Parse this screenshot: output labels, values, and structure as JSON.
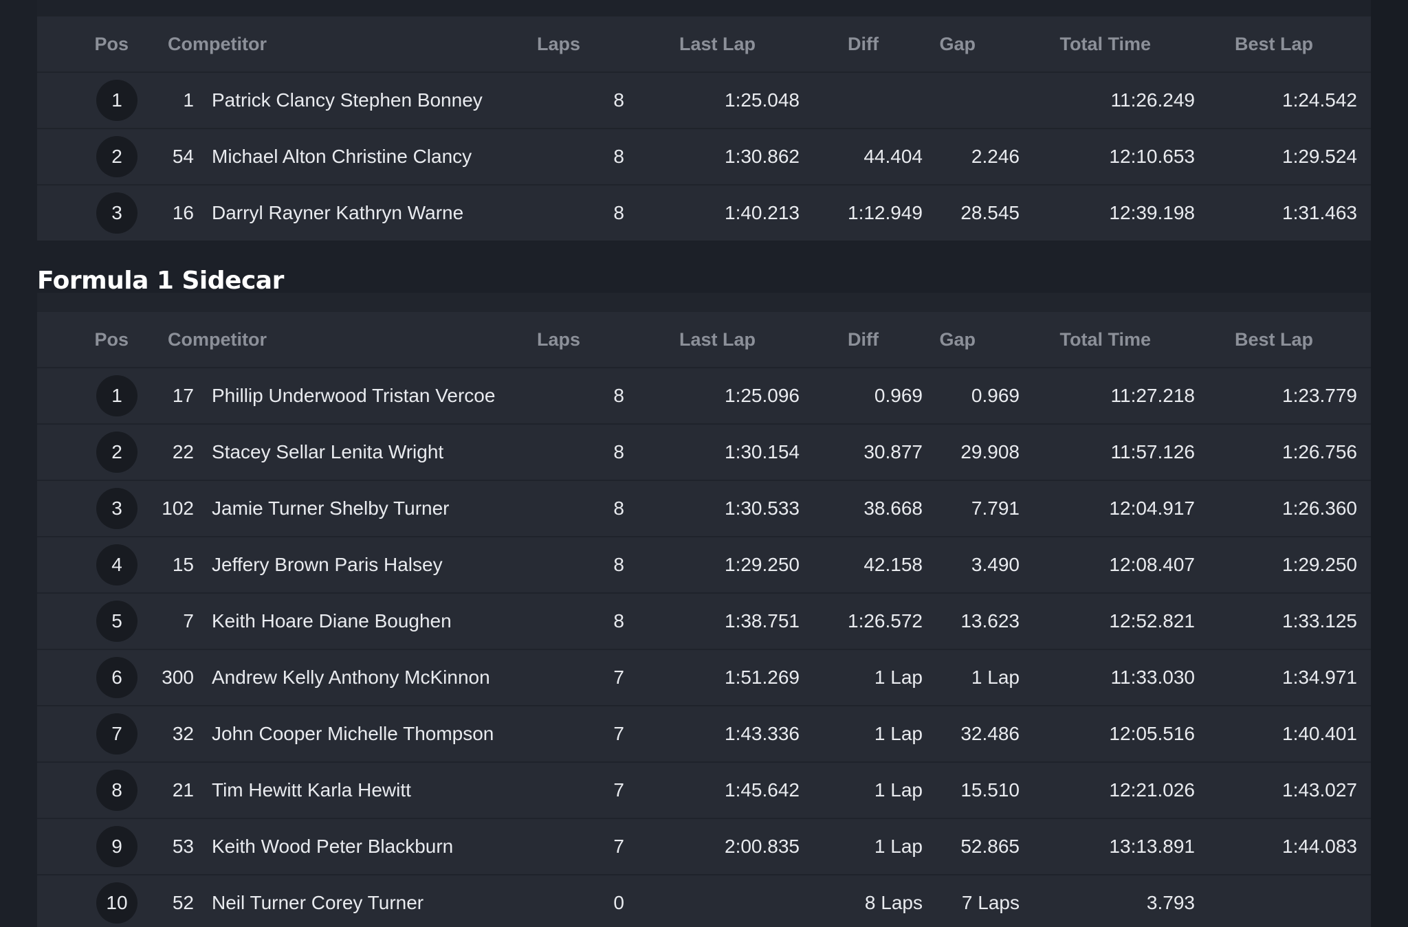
{
  "columns": {
    "pos": "Pos",
    "competitor": "Competitor",
    "laps": "Laps",
    "last_lap": "Last Lap",
    "diff": "Diff",
    "gap": "Gap",
    "total_time": "Total Time",
    "best_lap": "Best Lap"
  },
  "table1": {
    "rows": [
      {
        "pos": "1",
        "num": "1",
        "competitor": "Patrick Clancy Stephen Bonney",
        "laps": "8",
        "last_lap": "1:25.048",
        "diff": "",
        "gap": "",
        "total_time": "11:26.249",
        "best_lap": "1:24.542"
      },
      {
        "pos": "2",
        "num": "54",
        "competitor": "Michael Alton Christine Clancy",
        "laps": "8",
        "last_lap": "1:30.862",
        "diff": "44.404",
        "gap": "2.246",
        "total_time": "12:10.653",
        "best_lap": "1:29.524"
      },
      {
        "pos": "3",
        "num": "16",
        "competitor": "Darryl Rayner Kathryn Warne",
        "laps": "8",
        "last_lap": "1:40.213",
        "diff": "1:12.949",
        "gap": "28.545",
        "total_time": "12:39.198",
        "best_lap": "1:31.463"
      }
    ]
  },
  "section2": {
    "title": "Formula 1 Sidecar"
  },
  "table2": {
    "rows": [
      {
        "pos": "1",
        "num": "17",
        "competitor": "Phillip Underwood Tristan Vercoe",
        "laps": "8",
        "last_lap": "1:25.096",
        "diff": "0.969",
        "gap": "0.969",
        "total_time": "11:27.218",
        "best_lap": "1:23.779"
      },
      {
        "pos": "2",
        "num": "22",
        "competitor": "Stacey Sellar Lenita Wright",
        "laps": "8",
        "last_lap": "1:30.154",
        "diff": "30.877",
        "gap": "29.908",
        "total_time": "11:57.126",
        "best_lap": "1:26.756"
      },
      {
        "pos": "3",
        "num": "102",
        "competitor": "Jamie Turner Shelby Turner",
        "laps": "8",
        "last_lap": "1:30.533",
        "diff": "38.668",
        "gap": "7.791",
        "total_time": "12:04.917",
        "best_lap": "1:26.360"
      },
      {
        "pos": "4",
        "num": "15",
        "competitor": "Jeffery Brown Paris Halsey",
        "laps": "8",
        "last_lap": "1:29.250",
        "diff": "42.158",
        "gap": "3.490",
        "total_time": "12:08.407",
        "best_lap": "1:29.250"
      },
      {
        "pos": "5",
        "num": "7",
        "competitor": "Keith Hoare Diane Boughen",
        "laps": "8",
        "last_lap": "1:38.751",
        "diff": "1:26.572",
        "gap": "13.623",
        "total_time": "12:52.821",
        "best_lap": "1:33.125"
      },
      {
        "pos": "6",
        "num": "300",
        "competitor": "Andrew Kelly Anthony McKinnon",
        "laps": "7",
        "last_lap": "1:51.269",
        "diff": "1 Lap",
        "gap": "1 Lap",
        "total_time": "11:33.030",
        "best_lap": "1:34.971"
      },
      {
        "pos": "7",
        "num": "32",
        "competitor": "John Cooper Michelle Thompson",
        "laps": "7",
        "last_lap": "1:43.336",
        "diff": "1 Lap",
        "gap": "32.486",
        "total_time": "12:05.516",
        "best_lap": "1:40.401"
      },
      {
        "pos": "8",
        "num": "21",
        "competitor": "Tim Hewitt Karla Hewitt",
        "laps": "7",
        "last_lap": "1:45.642",
        "diff": "1 Lap",
        "gap": "15.510",
        "total_time": "12:21.026",
        "best_lap": "1:43.027"
      },
      {
        "pos": "9",
        "num": "53",
        "competitor": "Keith Wood Peter Blackburn",
        "laps": "7",
        "last_lap": "2:00.835",
        "diff": "1 Lap",
        "gap": "52.865",
        "total_time": "13:13.891",
        "best_lap": "1:44.083"
      },
      {
        "pos": "10",
        "num": "52",
        "competitor": "Neil Turner Corey Turner",
        "laps": "0",
        "last_lap": "",
        "diff": "8 Laps",
        "gap": "7 Laps",
        "total_time": "3.793",
        "best_lap": ""
      }
    ]
  }
}
